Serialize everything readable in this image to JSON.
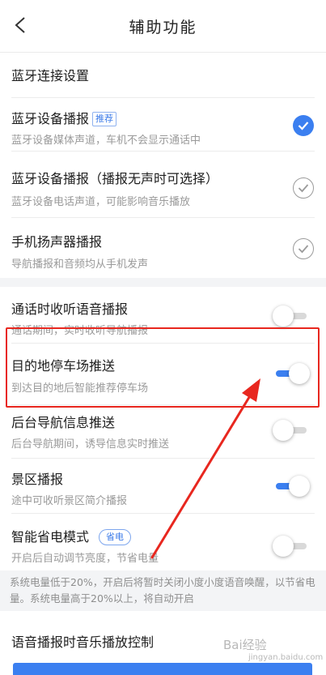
{
  "header": {
    "title": "辅助功能",
    "back_icon": "chevron-left-icon"
  },
  "rows": {
    "bt_settings": {
      "title": "蓝牙连接设置"
    },
    "bt_media": {
      "title": "蓝牙设备播报",
      "tag": "推荐",
      "subtitle": "蓝牙设备媒体声道，车机不会显示通话中",
      "checked": true
    },
    "bt_phone": {
      "title": "蓝牙设备播报（播报无声时可选择）",
      "subtitle": "蓝牙设备电话声道，可能影响音乐播放",
      "checked": false
    },
    "phone_speaker": {
      "title": "手机扬声器播报",
      "subtitle": "导航播报和音频均从手机发声",
      "checked": false
    },
    "call_voice": {
      "title": "通话时收听语音播报",
      "subtitle": "通话期间，实时收听导航播报",
      "enabled": false
    },
    "parking_push": {
      "title": "目的地停车场推送",
      "subtitle": "到达目的地后智能推荐停车场",
      "enabled": true
    },
    "background_push": {
      "title": "后台导航信息推送",
      "subtitle": "后台导航期间，诱导信息实时推送",
      "enabled": false
    },
    "scenic": {
      "title": "景区播报",
      "subtitle": "途中可收听景区简介播报",
      "enabled": true
    },
    "power_save": {
      "title": "智能省电模式",
      "tag": "省电",
      "subtitle": "开启后自动调节亮度，节省电量",
      "enabled": false
    },
    "music_control": {
      "title": "语音播报时音乐播放控制"
    }
  },
  "power_note": "系统电量低于20%，开启后将暂时关闭小度小度语音唤醒，以节省电量。系统电量高于20%以上，将自动开启",
  "watermark": {
    "text": "Bai经验",
    "sub": "jingyan.baidu.com"
  },
  "colors": {
    "accent": "#3b7ff0",
    "annotation_red": "#e8271f"
  }
}
